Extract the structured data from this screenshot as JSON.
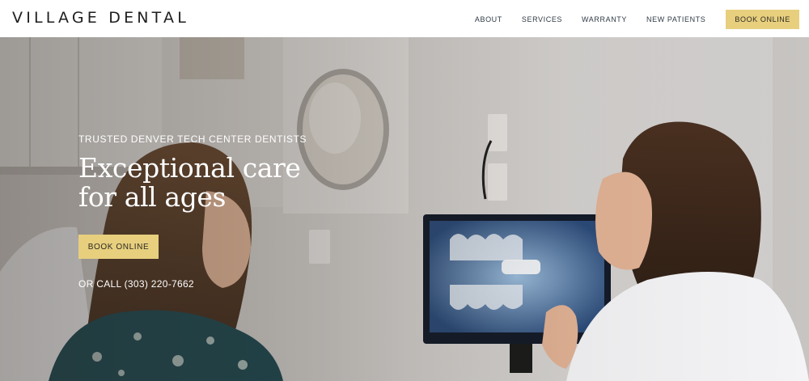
{
  "brand": {
    "logo_text": "VILLAGE DENTAL"
  },
  "nav": {
    "items": [
      {
        "label": "ABOUT"
      },
      {
        "label": "SERVICES"
      },
      {
        "label": "WARRANTY"
      },
      {
        "label": "NEW PATIENTS"
      }
    ],
    "cta_label": "BOOK ONLINE"
  },
  "hero": {
    "eyebrow": "TRUSTED DENVER TECH CENTER DENTISTS",
    "headline": "Exceptional care for all ages",
    "cta_label": "BOOK ONLINE",
    "phone_text": "OR CALL (303) 220-7662",
    "background_image": "dentist-showing-xray-on-monitor-to-patient"
  },
  "colors": {
    "accent": "#e7cf7e",
    "header_bg": "#ffffff",
    "hero_text": "#ffffff"
  }
}
